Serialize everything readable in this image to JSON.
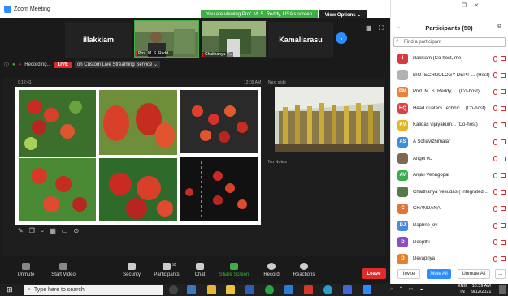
{
  "window": {
    "title": "Zoom Meeting"
  },
  "banner": {
    "viewing": "You are viewing Prof. M. S. Reddy, USA's screen",
    "view_options": "View Options ⌄"
  },
  "gallery": {
    "tiles": [
      {
        "name": "illakkiam"
      },
      {
        "name": "Prof. M. S. Redd..."
      },
      {
        "name": "Chaithanya Y..."
      },
      {
        "name": "Kamaliarasu"
      }
    ]
  },
  "recording": {
    "label": "Recording...",
    "live": "LIVE",
    "stream": "on Custom Live Streaming Service ⌄"
  },
  "share": {
    "left_time": "0:12:41",
    "right_time": "12:09 AM",
    "next_slide": "Next slide",
    "notes": "No Notes"
  },
  "toolbar": {
    "unmute": "Unmute",
    "start_video": "Start Video",
    "security": "Security",
    "participants": "Participants",
    "participants_count": "50",
    "chat": "Chat",
    "share_screen": "Share Screen",
    "record": "Record",
    "reactions": "Reactions",
    "leave": "Leave"
  },
  "panel": {
    "title": "Participants (50)",
    "search_placeholder": "Find a participant",
    "items": [
      {
        "initials": "I",
        "color": "#d9383c",
        "name": "illakkiam (Co-host, me)"
      },
      {
        "initials": "",
        "color": "#b2b2b2",
        "name": "BIOTECHNOLOGY DEPT-... (Host)"
      },
      {
        "initials": "PM",
        "color": "#e8823c",
        "name": "Prof. M. S. Reddy, ... (Co-host)"
      },
      {
        "initials": "HQ",
        "color": "#d64545",
        "name": "Head quaters Technic... (Co-host)"
      },
      {
        "initials": "KV",
        "color": "#e4b428",
        "name": "Kalidas vijayakum... (Co-host)"
      },
      {
        "initials": "AS",
        "color": "#3b8ed6",
        "name": "A Sofiavizhimalar"
      },
      {
        "initials": "",
        "color": "#7a6a52",
        "name": "Angel RJ"
      },
      {
        "initials": "AV",
        "color": "#3cae4e",
        "name": "Anjali Venugopal"
      },
      {
        "initials": "",
        "color": "#5a7a45",
        "name": "Chaithanya Yesudas ( integrated..."
      },
      {
        "initials": "C",
        "color": "#e0753a",
        "name": "CHANDANA"
      },
      {
        "initials": "DJ",
        "color": "#4a8ad6",
        "name": "Daphne joy"
      },
      {
        "initials": "D",
        "color": "#8b4cc4",
        "name": "Deepthi"
      },
      {
        "initials": "D",
        "color": "#e87f2a",
        "name": "Devapriya"
      }
    ],
    "invite": "Invite",
    "mute_all": "Mute All",
    "unmute_all": "Unmute All",
    "more": "..."
  },
  "taskbar": {
    "search": "Type here to search",
    "lang": "ENG",
    "lang2": "IN",
    "time": "10:39 AM",
    "date": "9/12/2021"
  }
}
